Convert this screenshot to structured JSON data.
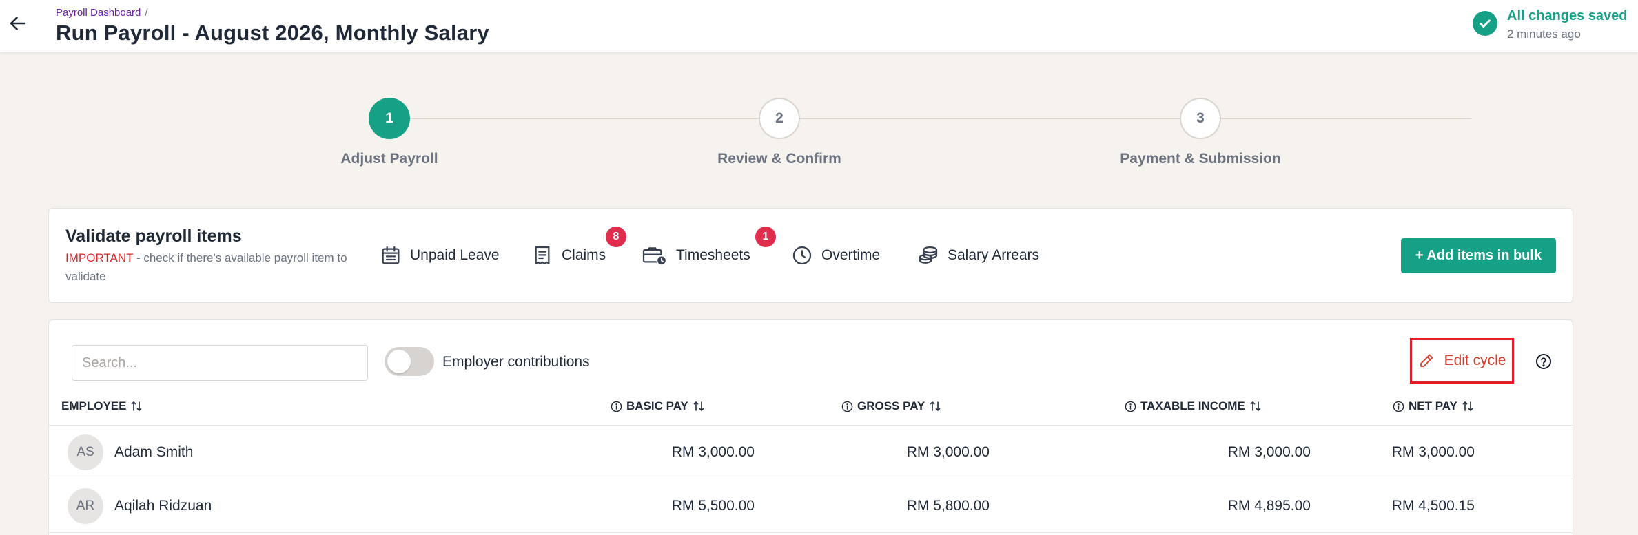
{
  "header": {
    "breadcrumb": "Payroll Dashboard",
    "breadcrumb_sep": "/",
    "title": "Run Payroll - August 2026, Monthly Salary",
    "save_status": "All changes saved",
    "save_time": "2 minutes ago",
    "accent_color": "#16a085"
  },
  "stepper": {
    "steps": [
      {
        "number": "1",
        "label": "Adjust Payroll",
        "state": "active"
      },
      {
        "number": "2",
        "label": "Review & Confirm",
        "state": "inactive"
      },
      {
        "number": "3",
        "label": "Payment & Submission",
        "state": "inactive"
      }
    ]
  },
  "validate": {
    "title": "Validate payroll items",
    "important": "IMPORTANT",
    "note": " - check if there's available payroll item to validate",
    "items": [
      {
        "label": "Unpaid Leave",
        "icon": "calendar-icon"
      },
      {
        "label": "Claims",
        "icon": "receipt-icon",
        "badge": "8"
      },
      {
        "label": "Timesheets",
        "icon": "briefcase-clock-icon",
        "badge": "1"
      },
      {
        "label": "Overtime",
        "icon": "clock-icon"
      },
      {
        "label": "Salary Arrears",
        "icon": "coins-icon"
      }
    ],
    "bulk_button": "+ Add items in bulk",
    "badge_color": "#e02d4e"
  },
  "table": {
    "search_placeholder": "Search...",
    "toggle_label": "Employer contributions",
    "toggle_on": false,
    "edit_cycle": "Edit cycle",
    "columns": {
      "employee": "EMPLOYEE",
      "basic": "BASIC PAY",
      "gross": "GROSS PAY",
      "taxable": "TAXABLE INCOME",
      "net": "NET PAY"
    },
    "rows": [
      {
        "initials": "AS",
        "name": "Adam Smith",
        "basic": "RM 3,000.00",
        "gross": "RM 3,000.00",
        "taxable": "RM 3,000.00",
        "net": "RM 3,000.00"
      },
      {
        "initials": "AR",
        "name": "Aqilah Ridzuan",
        "basic": "RM 5,500.00",
        "gross": "RM 5,800.00",
        "taxable": "RM 4,895.00",
        "net": "RM 4,500.15"
      }
    ]
  }
}
